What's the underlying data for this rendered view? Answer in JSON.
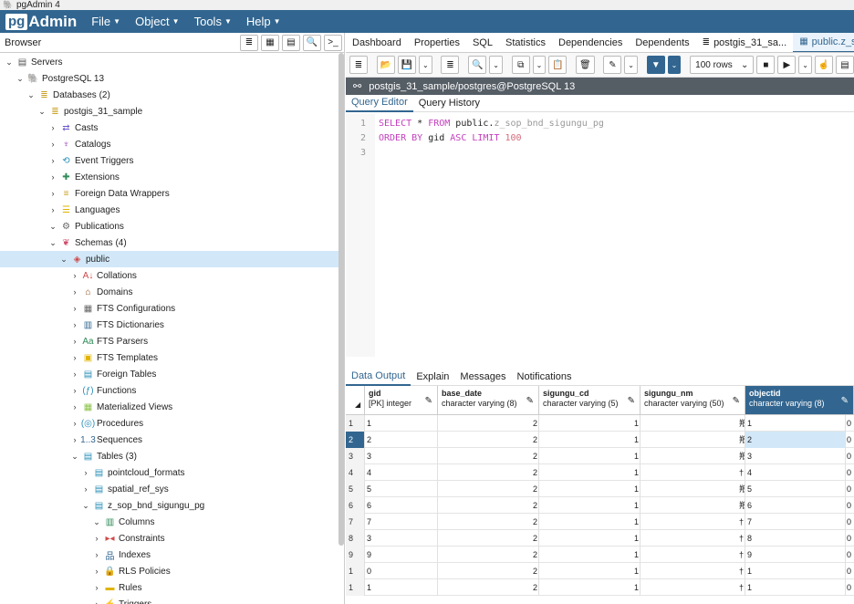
{
  "titlebar": {
    "title": "pgAdmin 4",
    "icon": "elephant-icon"
  },
  "menubar": {
    "logo_prefix": "pg",
    "logo_suffix": "Admin",
    "items": [
      "File",
      "Object",
      "Tools",
      "Help"
    ]
  },
  "browser": {
    "title": "Browser",
    "tree": [
      {
        "label": "Servers",
        "level": 0,
        "chev": "⌄",
        "icon": "▤",
        "icon_name": "servers-icon",
        "color": "#555"
      },
      {
        "label": "PostgreSQL 13",
        "level": 1,
        "chev": "⌄",
        "icon": "🐘",
        "icon_name": "postgres-server-icon",
        "color": "#336791"
      },
      {
        "label": "Databases (2)",
        "level": 2,
        "chev": "⌄",
        "icon": "≣",
        "icon_name": "databases-icon",
        "color": "#c9a227"
      },
      {
        "label": "postgis_31_sample",
        "level": 3,
        "chev": "⌄",
        "icon": "≣",
        "icon_name": "database-icon",
        "color": "#c9a227"
      },
      {
        "label": "Casts",
        "level": 4,
        "chev": "›",
        "icon": "⇄",
        "icon_name": "casts-icon",
        "color": "#6a5acd"
      },
      {
        "label": "Catalogs",
        "level": 4,
        "chev": "›",
        "icon": "♆",
        "icon_name": "catalogs-icon",
        "color": "#a044c0"
      },
      {
        "label": "Event Triggers",
        "level": 4,
        "chev": "›",
        "icon": "⟲",
        "icon_name": "event-triggers-icon",
        "color": "#2a8fb8"
      },
      {
        "label": "Extensions",
        "level": 4,
        "chev": "›",
        "icon": "✚",
        "icon_name": "extensions-icon",
        "color": "#2e8b57"
      },
      {
        "label": "Foreign Data Wrappers",
        "level": 4,
        "chev": "›",
        "icon": "≡",
        "icon_name": "foreign-data-wrappers-icon",
        "color": "#c9a227"
      },
      {
        "label": "Languages",
        "level": 4,
        "chev": "›",
        "icon": "☰",
        "icon_name": "languages-icon",
        "color": "#e0b400"
      },
      {
        "label": "Publications",
        "level": 4,
        "chev": "⌄",
        "icon": "⚙",
        "icon_name": "publications-icon",
        "color": "#666"
      },
      {
        "label": "Schemas (4)",
        "level": 4,
        "chev": "⌄",
        "icon": "❦",
        "icon_name": "schemas-icon",
        "color": "#d04a6a"
      },
      {
        "label": "public",
        "level": 5,
        "chev": "⌄",
        "icon": "◈",
        "icon_name": "schema-public-icon",
        "color": "#d04a4a",
        "selected": true
      },
      {
        "label": "Collations",
        "level": 6,
        "chev": "›",
        "icon": "A↓",
        "icon_name": "collations-icon",
        "color": "#d04a4a"
      },
      {
        "label": "Domains",
        "level": 6,
        "chev": "›",
        "icon": "⌂",
        "icon_name": "domains-icon",
        "color": "#8b4513"
      },
      {
        "label": "FTS Configurations",
        "level": 6,
        "chev": "›",
        "icon": "▦",
        "icon_name": "fts-configurations-icon",
        "color": "#666"
      },
      {
        "label": "FTS Dictionaries",
        "level": 6,
        "chev": "›",
        "icon": "▥",
        "icon_name": "fts-dictionaries-icon",
        "color": "#336791"
      },
      {
        "label": "FTS Parsers",
        "level": 6,
        "chev": "›",
        "icon": "Aa",
        "icon_name": "fts-parsers-icon",
        "color": "#2e8b57"
      },
      {
        "label": "FTS Templates",
        "level": 6,
        "chev": "›",
        "icon": "▣",
        "icon_name": "fts-templates-icon",
        "color": "#e0b400"
      },
      {
        "label": "Foreign Tables",
        "level": 6,
        "chev": "›",
        "icon": "▤",
        "icon_name": "foreign-tables-icon",
        "color": "#2a8fb8"
      },
      {
        "label": "Functions",
        "level": 6,
        "chev": "›",
        "icon": "(ƒ)",
        "icon_name": "functions-icon",
        "color": "#2a8fb8"
      },
      {
        "label": "Materialized Views",
        "level": 6,
        "chev": "›",
        "icon": "▦",
        "icon_name": "materialized-views-icon",
        "color": "#8bc34a"
      },
      {
        "label": "Procedures",
        "level": 6,
        "chev": "›",
        "icon": "(◎)",
        "icon_name": "procedures-icon",
        "color": "#2a8fb8"
      },
      {
        "label": "Sequences",
        "level": 6,
        "chev": "›",
        "icon": "1..3",
        "icon_name": "sequences-icon",
        "color": "#336791"
      },
      {
        "label": "Tables (3)",
        "level": 6,
        "chev": "⌄",
        "icon": "▤",
        "icon_name": "tables-icon",
        "color": "#2a8fb8"
      },
      {
        "label": "pointcloud_formats",
        "level": 7,
        "chev": "›",
        "icon": "▤",
        "icon_name": "table-icon",
        "color": "#2a8fb8"
      },
      {
        "label": "spatial_ref_sys",
        "level": 7,
        "chev": "›",
        "icon": "▤",
        "icon_name": "table-icon",
        "color": "#2a8fb8"
      },
      {
        "label": "z_sop_bnd_sigungu_pg",
        "level": 7,
        "chev": "⌄",
        "icon": "▤",
        "icon_name": "table-icon",
        "color": "#2a8fb8"
      },
      {
        "label": "Columns",
        "level": 8,
        "chev": "⌄",
        "icon": "▥",
        "icon_name": "columns-icon",
        "color": "#2e8b57"
      },
      {
        "label": "Constraints",
        "level": 8,
        "chev": "›",
        "icon": "▸◂",
        "icon_name": "constraints-icon",
        "color": "#d04a4a"
      },
      {
        "label": "Indexes",
        "level": 8,
        "chev": "›",
        "icon": "品",
        "icon_name": "indexes-icon",
        "color": "#336791"
      },
      {
        "label": "RLS Policies",
        "level": 8,
        "chev": "›",
        "icon": "🔒",
        "icon_name": "rls-policies-icon",
        "color": "#2e8b57"
      },
      {
        "label": "Rules",
        "level": 8,
        "chev": "›",
        "icon": "▬",
        "icon_name": "rules-icon",
        "color": "#e0b400"
      },
      {
        "label": "Triggers",
        "level": 8,
        "chev": "›",
        "icon": "⚡",
        "icon_name": "triggers-icon",
        "color": "#336791"
      }
    ]
  },
  "tabs": [
    {
      "label": "Dashboard"
    },
    {
      "label": "Properties"
    },
    {
      "label": "SQL"
    },
    {
      "label": "Statistics"
    },
    {
      "label": "Dependencies"
    },
    {
      "label": "Dependents"
    },
    {
      "label": "postgis_31_sa...",
      "icon": "≣",
      "icon_name": "database-tab-icon"
    },
    {
      "label": "public.z_sc",
      "icon": "▦",
      "icon_name": "query-tool-tab-icon",
      "active": true
    }
  ],
  "query_toolbar": {
    "rows_limit": "100 rows"
  },
  "connection": {
    "label": "postgis_31_sample/postgres@PostgreSQL 13"
  },
  "editor_tabs": [
    {
      "label": "Query Editor",
      "active": true
    },
    {
      "label": "Query History"
    }
  ],
  "editor": {
    "line_numbers": [
      "1",
      "2",
      "3"
    ],
    "line1": {
      "kw1": "SELECT",
      "star": " * ",
      "kw2": "FROM",
      "schema": " public.",
      "table": "z_sop_bnd_sigungu_pg"
    },
    "line2": {
      "kw1": "ORDER BY",
      "col": " gid ",
      "kw2": "ASC LIMIT",
      "num": " 100"
    }
  },
  "output_tabs": [
    {
      "label": "Data Output",
      "active": true
    },
    {
      "label": "Explain"
    },
    {
      "label": "Messages"
    },
    {
      "label": "Notifications"
    }
  ],
  "grid": {
    "columns": [
      {
        "name": "gid",
        "type": "[PK] integer"
      },
      {
        "name": "base_date",
        "type": "character varying (8)"
      },
      {
        "name": "sigungu_cd",
        "type": "character varying (5)"
      },
      {
        "name": "sigungu_nm",
        "type": "character varying (50)"
      },
      {
        "name": "objectid",
        "type": "character varying (8)",
        "active": true
      }
    ],
    "rows": [
      {
        "num": "1",
        "gid": "1",
        "base": "2",
        "cd": "1",
        "nm": "羪",
        "obj": "1",
        "extra": "0"
      },
      {
        "num": "2",
        "gid": "2",
        "base": "2",
        "cd": "1",
        "nm": "羪",
        "obj": "2",
        "extra": "0",
        "selected": true
      },
      {
        "num": "3",
        "gid": "3",
        "base": "2",
        "cd": "1",
        "nm": "羪",
        "obj": "3",
        "extra": "0"
      },
      {
        "num": "4",
        "gid": "4",
        "base": "2",
        "cd": "1",
        "nm": "†",
        "obj": "4",
        "extra": "0"
      },
      {
        "num": "5",
        "gid": "5",
        "base": "2",
        "cd": "1",
        "nm": "羪",
        "obj": "5",
        "extra": "0"
      },
      {
        "num": "6",
        "gid": "6",
        "base": "2",
        "cd": "1",
        "nm": "羪",
        "obj": "6",
        "extra": "0"
      },
      {
        "num": "7",
        "gid": "7",
        "base": "2",
        "cd": "1",
        "nm": "†",
        "obj": "7",
        "extra": "0"
      },
      {
        "num": "8",
        "gid": "3",
        "base": "2",
        "cd": "1",
        "nm": "†",
        "obj": "8",
        "extra": "0"
      },
      {
        "num": "9",
        "gid": "9",
        "base": "2",
        "cd": "1",
        "nm": "†",
        "obj": "9",
        "extra": "0"
      },
      {
        "num": "1",
        "gid": "0",
        "base": "2",
        "cd": "1",
        "nm": "†",
        "obj": "1",
        "extra": "0"
      },
      {
        "num": "1",
        "gid": "1",
        "base": "2",
        "cd": "1",
        "nm": "†",
        "obj": "1",
        "extra": "0"
      }
    ]
  }
}
